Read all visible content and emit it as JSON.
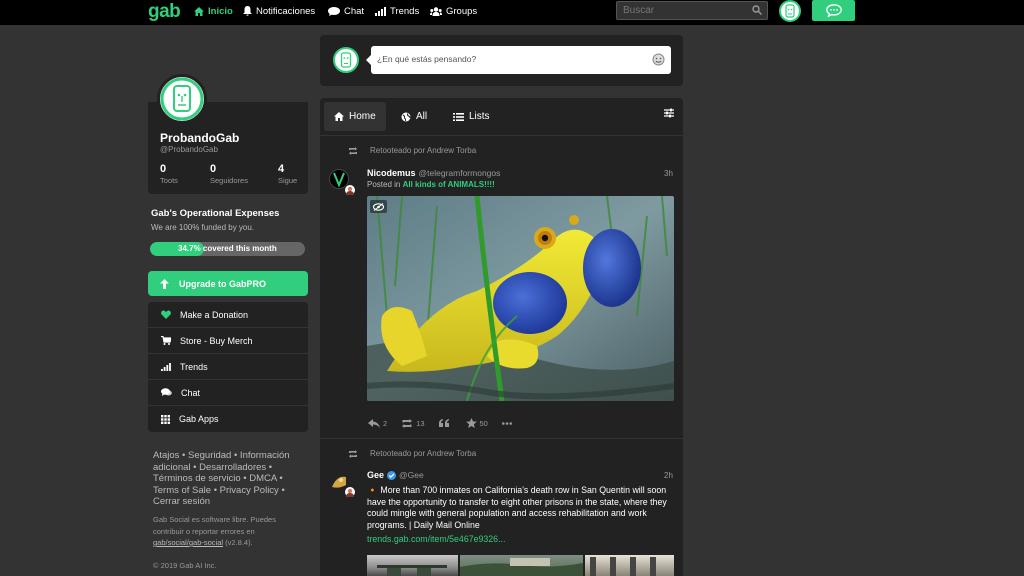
{
  "topbar": {
    "logo": "gab",
    "nav": [
      {
        "label": "Inicio",
        "icon": "home-icon",
        "active": true
      },
      {
        "label": "Notificaciones",
        "icon": "bell-icon"
      },
      {
        "label": "Chat",
        "icon": "chat-icon"
      },
      {
        "label": "Trends",
        "icon": "trends-icon"
      },
      {
        "label": "Groups",
        "icon": "groups-icon"
      }
    ],
    "search_placeholder": "Buscar"
  },
  "profile": {
    "name": "ProbandoGab",
    "handle": "@ProbandoGab",
    "stats": [
      {
        "value": "0",
        "label": "Toots"
      },
      {
        "value": "0",
        "label": "Seguidores"
      },
      {
        "value": "4",
        "label": "Sigue"
      }
    ]
  },
  "opex": {
    "title": "Gab's Operational Expenses",
    "subtitle": "We are 100% funded by you.",
    "percent": 34.7,
    "percent_label": "34.7%",
    "progress_label": "covered this month"
  },
  "upgrade_label": "Upgrade to GabPRO",
  "menu": [
    {
      "label": "Make a Donation",
      "icon": "heart-icon"
    },
    {
      "label": "Store - Buy Merch",
      "icon": "cart-icon"
    },
    {
      "label": "Trends",
      "icon": "trends-icon"
    },
    {
      "label": "Chat",
      "icon": "chat-icon"
    },
    {
      "label": "Gab Apps",
      "icon": "apps-grid-icon"
    }
  ],
  "footer": {
    "links": "Atajos • Seguridad • Información adicional • Desarrolladores • Términos de servicio • DMCA • Terms of Sale • Privacy Policy • Cerrar sesión",
    "note_prefix": "Gab Social es software libre. Puedes contribuir o reportar errores en",
    "note_link": "gab/social/gab-social",
    "note_version": "(v2.8.4).",
    "copyright": "© 2019 Gab AI Inc."
  },
  "compose": {
    "placeholder": "¿En qué estás pensando?"
  },
  "feed": {
    "tabs": [
      {
        "label": "Home",
        "icon": "home-icon",
        "active": true
      },
      {
        "label": "All",
        "icon": "globe-icon"
      },
      {
        "label": "Lists",
        "icon": "list-icon"
      }
    ]
  },
  "posts": [
    {
      "retooted_by": "Retooteado por Andrew Torba",
      "author_name": "Nicodemus",
      "author_handle": "@telegramformongos",
      "time": "3h",
      "posted_in_prefix": "Posted in",
      "group": "All kinds of ANIMALS!!!!",
      "actions": {
        "replies": "2",
        "reposts": "13",
        "likes": "50"
      }
    },
    {
      "retooted_by": "Retooteado por Andrew Torba",
      "author_name": "Gee",
      "author_handle": "@Gee",
      "time": "2h",
      "text": "🔸 More than 700 inmates on California's death row in San Quentin will soon have the opportunity to transfer to eight other prisons in the state, where they could mingle with general population and access rehabilitation and work programs. | Daily Mail Online",
      "link": "trends.gab.com/item/5e467e9326..."
    }
  ],
  "colors": {
    "accent": "#30ce7d",
    "background": "#333333",
    "card": "#222222"
  }
}
